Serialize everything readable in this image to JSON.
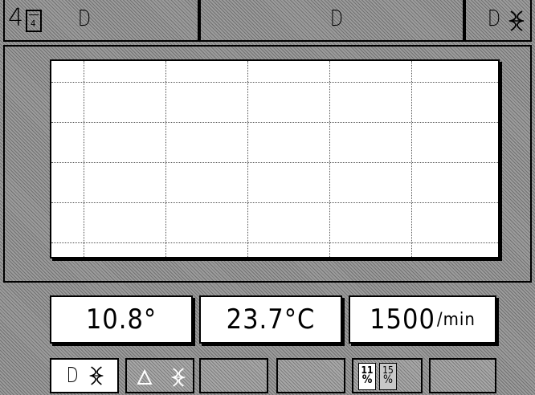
{
  "header": {
    "mode_number": "4",
    "mode_icon_digit": "4",
    "left_label": "D",
    "center_label": "D",
    "right_label": "D",
    "icons": {
      "mode": "page-icon",
      "fan": "fan-icon"
    }
  },
  "graph": {
    "grid": true
  },
  "readouts": {
    "angle": "10.8°",
    "temperature": "23.7°C",
    "speed_value": "1500",
    "speed_unit": "/min"
  },
  "buttons": {
    "d_label": "D",
    "percent_active": {
      "top": "11",
      "bottom": "%"
    },
    "percent_alt": {
      "top": "15",
      "bottom": "%"
    }
  }
}
